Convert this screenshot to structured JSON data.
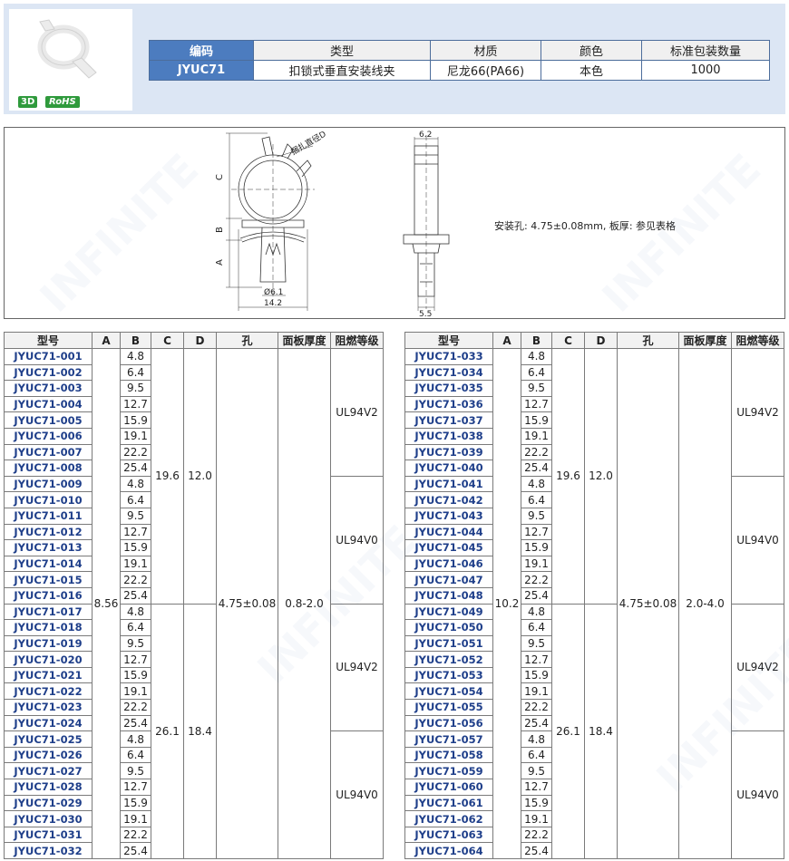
{
  "header": {
    "badges": {
      "three_d": "3D",
      "rohs": "RoHS"
    },
    "spec": {
      "headers": [
        "编码",
        "类型",
        "材质",
        "颜色",
        "标准包装数量"
      ],
      "values": [
        "JYUC71",
        "扣锁式垂直安装线夹",
        "尼龙66(PA66)",
        "本色",
        "1000"
      ]
    }
  },
  "drawing": {
    "labels": {
      "c": "C",
      "b": "B",
      "a": "A",
      "bundle": "捆扎直径D",
      "hole_dia": "Ø6.1",
      "width": "14.2",
      "top_width": "6.2",
      "bottom_width": "5.5"
    },
    "install_note": "安装孔: 4.75±0.08mm, 板厚: 参见表格"
  },
  "table_headers": [
    "型号",
    "A",
    "B",
    "C",
    "D",
    "孔",
    "面板厚度",
    "阻燃等级"
  ],
  "b_values": [
    "4.8",
    "6.4",
    "9.5",
    "12.7",
    "15.9",
    "19.1",
    "22.2",
    "25.4"
  ],
  "left_table": {
    "models": [
      "JYUC71-001",
      "JYUC71-002",
      "JYUC71-003",
      "JYUC71-004",
      "JYUC71-005",
      "JYUC71-006",
      "JYUC71-007",
      "JYUC71-008",
      "JYUC71-009",
      "JYUC71-010",
      "JYUC71-011",
      "JYUC71-012",
      "JYUC71-013",
      "JYUC71-014",
      "JYUC71-015",
      "JYUC71-016",
      "JYUC71-017",
      "JYUC71-018",
      "JYUC71-019",
      "JYUC71-020",
      "JYUC71-021",
      "JYUC71-022",
      "JYUC71-023",
      "JYUC71-024",
      "JYUC71-025",
      "JYUC71-026",
      "JYUC71-027",
      "JYUC71-028",
      "JYUC71-029",
      "JYUC71-030",
      "JYUC71-031",
      "JYUC71-032"
    ],
    "a": "8.56",
    "c": [
      "19.6",
      "26.1"
    ],
    "d": [
      "12.0",
      "18.4"
    ],
    "hole": "4.75±0.08",
    "panel": "0.8-2.0",
    "rating": [
      "UL94V2",
      "UL94V0",
      "UL94V2",
      "UL94V0"
    ]
  },
  "right_table": {
    "models": [
      "JYUC71-033",
      "JYUC71-034",
      "JYUC71-035",
      "JYUC71-036",
      "JYUC71-037",
      "JYUC71-038",
      "JYUC71-039",
      "JYUC71-040",
      "JYUC71-041",
      "JYUC71-042",
      "JYUC71-043",
      "JYUC71-044",
      "JYUC71-045",
      "JYUC71-046",
      "JYUC71-047",
      "JYUC71-048",
      "JYUC71-049",
      "JYUC71-050",
      "JYUC71-051",
      "JYUC71-052",
      "JYUC71-053",
      "JYUC71-054",
      "JYUC71-055",
      "JYUC71-056",
      "JYUC71-057",
      "JYUC71-058",
      "JYUC71-059",
      "JYUC71-060",
      "JYUC71-061",
      "JYUC71-062",
      "JYUC71-063",
      "JYUC71-064"
    ],
    "a": "10.2",
    "c": [
      "19.6",
      "26.1"
    ],
    "d": [
      "12.0",
      "18.4"
    ],
    "hole": "4.75±0.08",
    "panel": "2.0-4.0",
    "rating": [
      "UL94V2",
      "UL94V0",
      "UL94V2",
      "UL94V0"
    ]
  }
}
